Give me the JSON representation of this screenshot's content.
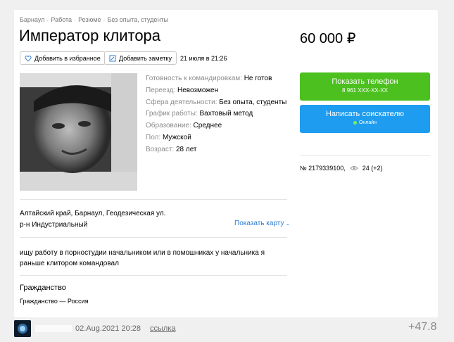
{
  "breadcrumb": [
    "Барнаул",
    "Работа",
    "Резюме",
    "Без опыта, студенты"
  ],
  "breadcrumb_sep": "·",
  "title": "Император клитора",
  "price": "60 000 ₽",
  "actions": {
    "favorite_label": "Добавить в избранное",
    "note_label": "Добавить заметку",
    "date": "21 июля в 21:26"
  },
  "params": [
    {
      "key": "Готовность к командировкам:",
      "value": "Не готов"
    },
    {
      "key": "Переезд:",
      "value": "Невозможен"
    },
    {
      "key": "Сфера деятельности:",
      "value": "Без опыта, студенты"
    },
    {
      "key": "График работы:",
      "value": "Вахтовый метод"
    },
    {
      "key": "Образование:",
      "value": "Среднее"
    },
    {
      "key": "Пол:",
      "value": "Мужской"
    },
    {
      "key": "Возраст:",
      "value": "28 лет"
    }
  ],
  "address": {
    "line1": "Алтайский край, Барнаул, Геодезическая ул.",
    "line2": "р-н Индустриальный",
    "map_link": "Показать карту"
  },
  "description": "ищу работу в порностудии начальником или в помошниках у начальника я раньше клитором командовал",
  "citizenship": {
    "title": "Гражданство",
    "value": "Гражданство — Россия"
  },
  "contact": {
    "call_label": "Показать телефон",
    "phone": "8 961 XXX-XX-XX",
    "message_label": "Написать соискателю",
    "online": "Онлайн"
  },
  "listing": {
    "number": "№ 2179339100,",
    "views": "24 (+2)"
  },
  "footer": {
    "date": "02.Aug.2021",
    "time": "20:28",
    "link": "ссылка",
    "score": "+47.8"
  },
  "colors": {
    "call_button": "#4bc01e",
    "message_button": "#1e9cf0",
    "link": "#2d7cd1"
  }
}
